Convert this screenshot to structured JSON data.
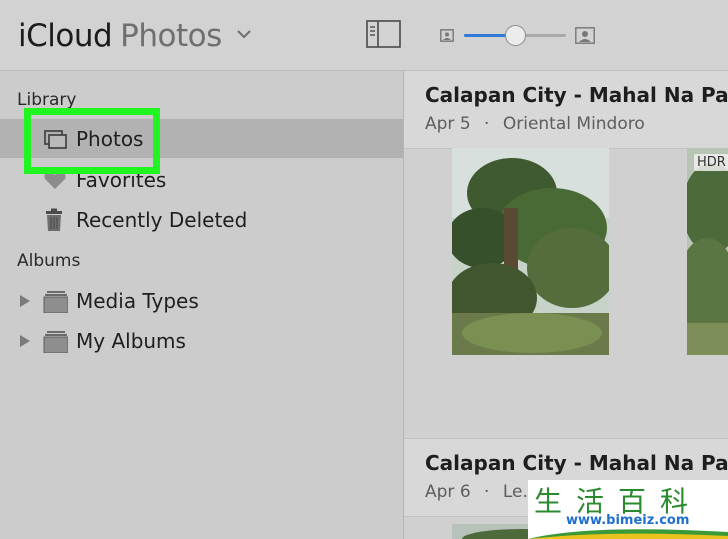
{
  "header": {
    "brand": "iCloud",
    "section": "Photos",
    "icons": [
      "chevron-down-icon",
      "sidebar-toggle-icon",
      "zoom-small-icon",
      "zoom-large-icon"
    ],
    "zoom_level": 0.5
  },
  "sidebar": {
    "library_heading": "Library",
    "albums_heading": "Albums",
    "library_items": [
      {
        "label": "Photos",
        "icon": "photos-stack-icon",
        "selected": true
      },
      {
        "label": "Favorites",
        "icon": "heart-icon",
        "selected": false
      },
      {
        "label": "Recently Deleted",
        "icon": "trash-icon",
        "selected": false
      }
    ],
    "album_items": [
      {
        "label": "Media Types",
        "icon": "album-stack-icon"
      },
      {
        "label": "My Albums",
        "icon": "album-stack-icon"
      }
    ]
  },
  "main": {
    "moments": [
      {
        "title": "Calapan City - Mahal Na Pan",
        "date": "Apr 5",
        "location": "Oriental Mindoro"
      },
      {
        "title": "Calapan City - Mahal Na Pan",
        "date": "Apr 6",
        "location": "Le..."
      }
    ],
    "badges": [
      "HDR"
    ]
  },
  "watermark": {
    "chinese": "生活百科",
    "url": "www.bimeiz.com"
  },
  "colors": {
    "accent": "#2e7ad6",
    "highlight": "#20f520",
    "selected_row": "#b2b2b2"
  }
}
